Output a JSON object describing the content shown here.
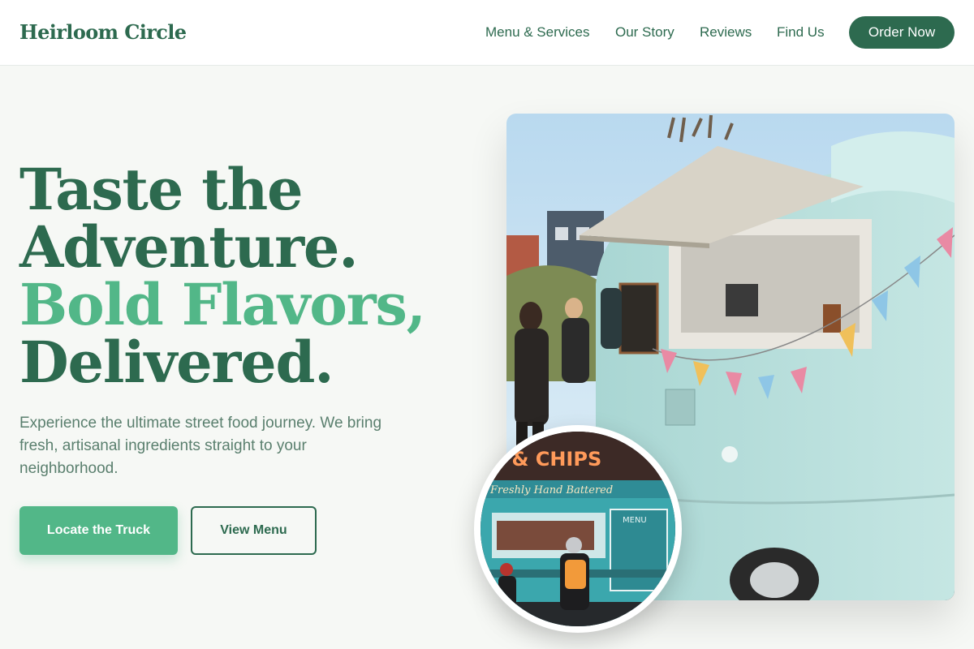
{
  "brand": "Heirloom Circle",
  "nav": {
    "links": [
      "Menu & Services",
      "Our Story",
      "Reviews",
      "Find Us"
    ],
    "cta": "Order Now"
  },
  "hero": {
    "headline": [
      "Taste the",
      "Adventure.",
      "Bold Flavors,",
      "Delivered."
    ],
    "subtext": "Experience the ultimate street food journey. We bring fresh, artisanal ingredients straight to your neighborhood.",
    "primary_cta": "Locate the Truck",
    "secondary_cta": "View Menu"
  },
  "inset_image": {
    "sign_top": "H & CHIPS",
    "sign_sub": "Freshly Hand Battered",
    "menu_label": "MENU"
  },
  "colors": {
    "primary": "#2d6a4f",
    "accent": "#52b788",
    "background": "#f6f8f5",
    "muted_text": "#5a7f6e"
  }
}
